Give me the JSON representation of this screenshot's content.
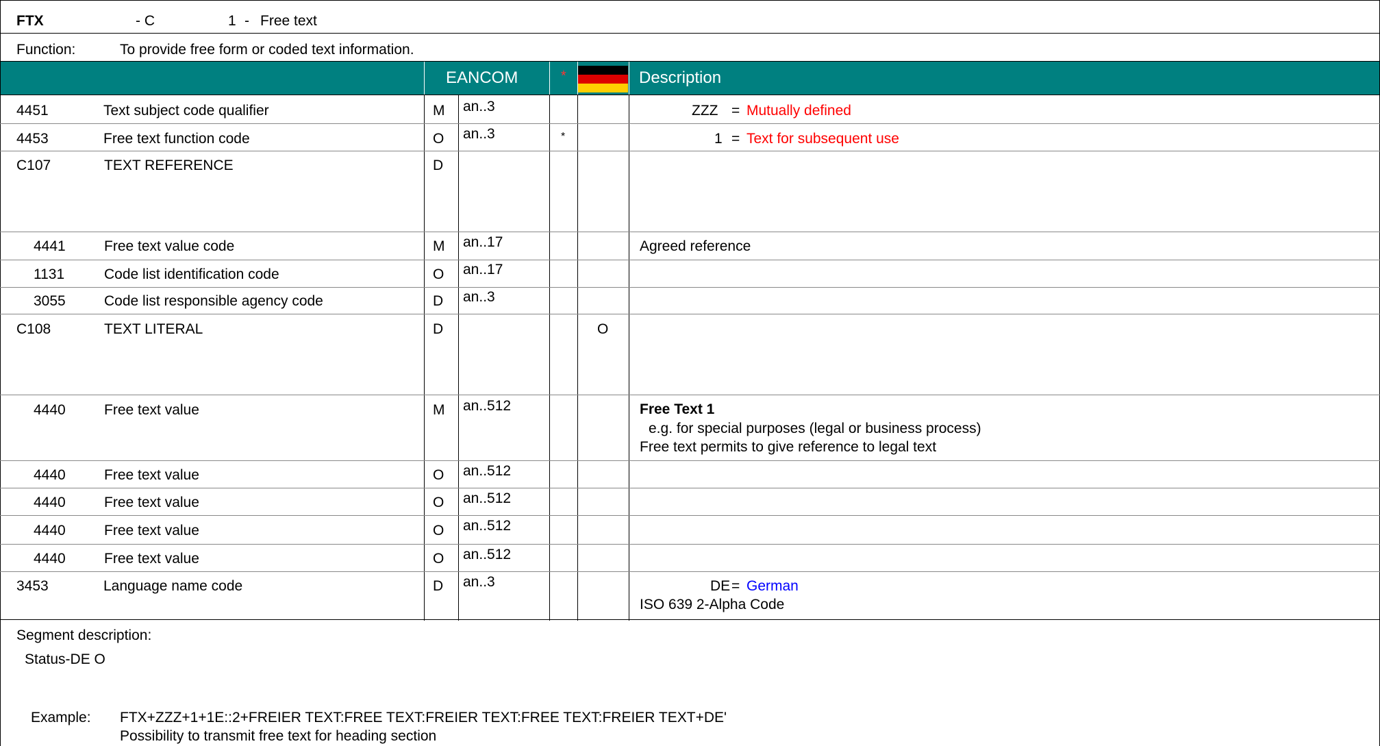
{
  "segment": {
    "tag": "FTX",
    "status": "- C",
    "repeat": "1",
    "dash": "-",
    "name": "Free text"
  },
  "function": {
    "label": "Function:",
    "text": "To provide free form or coded text information."
  },
  "header": {
    "eancom": "EANCOM",
    "star": "*",
    "description": "Description"
  },
  "rows": [
    {
      "code": "4451",
      "name": "Text subject code qualifier",
      "status": "M",
      "format": "an..3",
      "star": "",
      "de": "",
      "value_code": "ZZZ",
      "eq": "=",
      "value_text": "Mutually defined"
    },
    {
      "code": "4453",
      "name": "Free text function code",
      "status": "O",
      "format": "an..3",
      "star": "*",
      "de": "",
      "value_code": "1",
      "eq": "=",
      "value_text": "Text for subsequent use"
    },
    {
      "code": "C107",
      "name": "TEXT REFERENCE",
      "status": "D",
      "format": "",
      "star": "",
      "de": ""
    },
    {
      "code": "4441",
      "name": "Free text value code",
      "status": "M",
      "format": "an..17",
      "star": "",
      "de": "",
      "desc": "Agreed reference"
    },
    {
      "code": "1131",
      "name": "Code list identification code",
      "status": "O",
      "format": "an..17",
      "star": "",
      "de": ""
    },
    {
      "code": "3055",
      "name": "Code list responsible agency code",
      "status": "D",
      "format": "an..3",
      "star": "",
      "de": ""
    },
    {
      "code": "C108",
      "name": "TEXT LITERAL",
      "status": "D",
      "format": "",
      "star": "",
      "de": "O"
    },
    {
      "code": "4440",
      "name": "Free text value",
      "status": "M",
      "format": "an..512",
      "star": "",
      "de": "",
      "desc_title": "Free Text 1",
      "desc_line1": "e.g. for special purposes (legal or business process)",
      "desc_line2": "Free text permits to give reference to legal text"
    },
    {
      "code": "4440",
      "name": "Free text value",
      "status": "O",
      "format": "an..512",
      "star": "",
      "de": ""
    },
    {
      "code": "4440",
      "name": "Free text value",
      "status": "O",
      "format": "an..512",
      "star": "",
      "de": ""
    },
    {
      "code": "4440",
      "name": "Free text value",
      "status": "O",
      "format": "an..512",
      "star": "",
      "de": ""
    },
    {
      "code": "4440",
      "name": "Free text value",
      "status": "O",
      "format": "an..512",
      "star": "",
      "de": ""
    },
    {
      "code": "3453",
      "name": "Language name code",
      "status": "D",
      "format": "an..3",
      "star": "",
      "de": "",
      "value_code": "DE",
      "eq": "=",
      "value_text": "German",
      "desc_line2": "ISO 639 2-Alpha Code"
    }
  ],
  "footer": {
    "segment_label": "Segment description:",
    "status_de": "Status-DE O",
    "example_label": "Example:",
    "example_text": "FTX+ZZZ+1+1E::2+FREIER TEXT:FREE TEXT:FREIER TEXT:FREE TEXT:FREIER TEXT+DE'",
    "example_note": "Possibility to transmit free text for heading section"
  },
  "colors": {
    "header_bg": "#008080",
    "code_value": "#ff0000",
    "language_value": "#0000ff",
    "flag": [
      "#000000",
      "#dd0000",
      "#ffce00"
    ]
  },
  "icons": {
    "flag": "german-flag-icon"
  }
}
